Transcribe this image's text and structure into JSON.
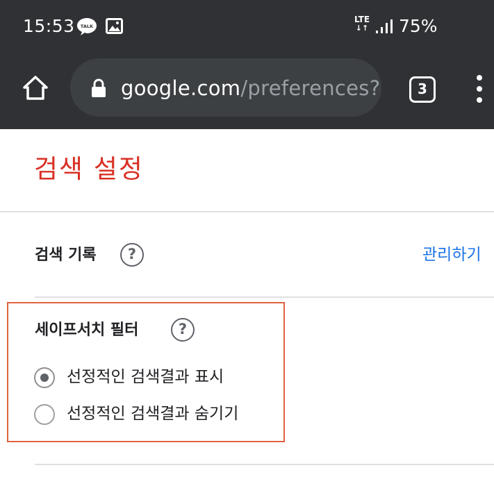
{
  "status_bar": {
    "time": "15:53",
    "talk_badge": "TALK",
    "network": "LTE",
    "battery": "75%",
    "icons": [
      "kakaotalk-icon",
      "gallery-icon",
      "lte-icon",
      "signal-icon"
    ]
  },
  "toolbar": {
    "url_domain": "google.com",
    "url_path": "/preferences?l",
    "tab_count": "3",
    "icons": [
      "home-icon",
      "lock-icon",
      "more-vert-icon"
    ]
  },
  "page": {
    "title": "검색 설정",
    "search_history": {
      "label": "검색 기록",
      "help": "?",
      "manage_link": "관리하기"
    },
    "safesearch": {
      "label": "세이프서치 필터",
      "help": "?",
      "options": [
        {
          "label": "선정적인 검색결과 표시",
          "selected": true
        },
        {
          "label": "선정적인 검색결과 숨기기",
          "selected": false
        }
      ]
    }
  },
  "colors": {
    "chrome_dark": "#303134",
    "omnibox": "#3c4043",
    "title_red": "#d93025",
    "link_blue": "#1a73e8",
    "highlight_box": "#e0623f"
  }
}
